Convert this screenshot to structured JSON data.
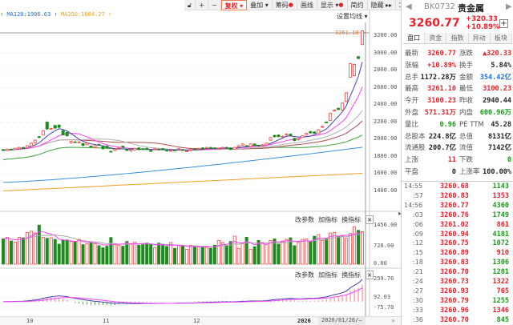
{
  "toolbar": {
    "items": [
      "复权",
      "叠加",
      "筹码",
      "画线",
      "显示",
      "简约",
      "隐藏"
    ],
    "lock_icon": "lock-icon",
    "zoom_in": "+",
    "zoom_out": "−",
    "expand_icon": "fullscreen-icon"
  },
  "legend": {
    "ma120": "MA120:1906.63",
    "ma250": "MA250:1604.27",
    "set_ma": "设置均线 ▾"
  },
  "colors": {
    "up": "#f04848",
    "down": "#1f8a1f",
    "ma5": "#4040b0",
    "ma10": "#ff40ff",
    "ma20": "#b0b0b0",
    "ma30": "#b04848",
    "ma60": "#3aa03a",
    "ma120": "#3a90e0",
    "ma250": "#f0a020"
  },
  "chart_data": {
    "type": "candlestick",
    "price_axis": [
      "3200.00",
      "3000.00",
      "2800.00",
      "2600.00",
      "2400.00",
      "2200.00",
      "2000.00",
      "1800.00",
      "1600.00",
      "1400.00"
    ],
    "price_ticks": [
      3200,
      3000,
      2800,
      2600,
      2400,
      2200,
      2000,
      1800,
      1600,
      1400
    ],
    "high_label": "3261.10",
    "high_value": 3261.1,
    "ma_end": {
      "ma120": 1906.63,
      "ma250": 1604.27
    },
    "candles": [
      [
        1880,
        1870
      ],
      [
        1870,
        1885
      ],
      [
        1885,
        1878
      ],
      [
        1880,
        1895
      ],
      [
        1890,
        1905
      ],
      [
        1905,
        1900
      ],
      [
        1900,
        1925
      ],
      [
        1920,
        1955
      ],
      [
        1960,
        1990
      ],
      [
        2030,
        2020
      ],
      [
        2050,
        2100
      ],
      [
        2200,
        2120
      ],
      [
        2120,
        2125
      ],
      [
        2160,
        2130
      ],
      [
        2165,
        2140
      ],
      [
        2100,
        2050
      ],
      [
        2080,
        2040
      ],
      [
        1960,
        1975
      ],
      [
        1970,
        1968
      ],
      [
        1960,
        1970
      ],
      [
        1950,
        1930
      ],
      [
        1935,
        1955
      ],
      [
        1920,
        1915
      ],
      [
        1905,
        1925
      ],
      [
        1940,
        1930
      ],
      [
        1915,
        1890
      ],
      [
        1920,
        1900
      ],
      [
        1860,
        1850
      ],
      [
        1870,
        1885
      ],
      [
        1895,
        1905
      ],
      [
        1920,
        1905
      ],
      [
        1880,
        1870
      ],
      [
        1865,
        1880
      ],
      [
        1875,
        1895
      ],
      [
        1900,
        1880
      ],
      [
        1890,
        1885
      ],
      [
        1895,
        1880
      ],
      [
        1870,
        1860
      ],
      [
        1880,
        1890
      ],
      [
        1885,
        1882
      ],
      [
        1890,
        1880
      ],
      [
        1875,
        1865
      ],
      [
        1860,
        1870
      ],
      [
        1875,
        1872
      ],
      [
        1880,
        1890
      ],
      [
        1880,
        1870
      ],
      [
        1860,
        1865
      ],
      [
        1870,
        1880
      ],
      [
        1885,
        1880
      ],
      [
        1890,
        1893
      ],
      [
        1900,
        1890
      ],
      [
        1895,
        1905
      ],
      [
        1905,
        1895
      ],
      [
        1900,
        1898
      ],
      [
        1890,
        1895
      ],
      [
        1895,
        1905
      ],
      [
        1905,
        1898
      ],
      [
        1900,
        1880
      ],
      [
        1885,
        1905
      ],
      [
        1910,
        1925
      ],
      [
        1930,
        1945
      ],
      [
        1925,
        1915
      ],
      [
        1915,
        1945
      ],
      [
        1945,
        1925
      ],
      [
        1930,
        1920
      ],
      [
        1925,
        1935
      ],
      [
        1935,
        1955
      ],
      [
        1990,
        2020
      ],
      [
        2045,
        2030
      ],
      [
        2050,
        2030
      ],
      [
        2030,
        2035
      ],
      [
        2050,
        2060
      ],
      [
        2060,
        2045
      ],
      [
        2010,
        1985
      ],
      [
        1995,
        2010
      ],
      [
        2020,
        2040
      ],
      [
        2050,
        2070
      ],
      [
        2090,
        2075
      ],
      [
        2085,
        2070
      ],
      [
        2065,
        2110
      ],
      [
        2140,
        2150
      ],
      [
        2200,
        2195
      ],
      [
        2220,
        2300
      ],
      [
        2330,
        2340
      ],
      [
        2360,
        2345
      ],
      [
        2340,
        2420
      ],
      [
        2440,
        2540
      ],
      [
        2720,
        2880
      ],
      [
        2740,
        2870
      ],
      [
        2960,
        2940.44
      ],
      [
        3100.23,
        3260.77
      ]
    ],
    "volume_axis": [
      "1456.00",
      "728.00",
      "0.00"
    ],
    "volume_max": 1456,
    "volumes": [
      960,
      1010,
      880,
      840,
      1020,
      1000,
      1200,
      1250,
      1180,
      1480,
      1020,
      980,
      1000,
      940,
      760,
      920,
      920,
      860,
      850,
      940,
      740,
      780,
      820,
      780,
      700,
      620,
      680,
      1010,
      740,
      720,
      680,
      860,
      780,
      830,
      720,
      740,
      800,
      760,
      620,
      800,
      710,
      670,
      820,
      600,
      720,
      700,
      560,
      720,
      660,
      650,
      680,
      640,
      600,
      720,
      900,
      820,
      700,
      860,
      1060,
      600,
      800,
      1020,
      560,
      660,
      900,
      820,
      760,
      900,
      960,
      760,
      880,
      940,
      1000,
      700,
      820,
      940,
      960,
      860,
      1060,
      1120,
      900,
      960,
      1180,
      1200,
      1060,
      1060,
      980,
      1160,
      1420,
      1280,
      1230
    ],
    "macd_axis": [
      "259.76",
      "92.03",
      "-75.70"
    ],
    "macd_ticks": [
      259.76,
      92.03,
      -75.7
    ],
    "x_labels": [
      "10",
      "11",
      "12",
      "2026"
    ],
    "cursor_date": "2026/01/26/—"
  },
  "panels": {
    "edit_params": "改参数",
    "add_indicator": "加指标",
    "switch_indicator": "换指标",
    "close": "×"
  },
  "quote": {
    "code": "BK0732",
    "name": "贵金属",
    "price": "3260.77",
    "change": "+320.33",
    "change_pct": "+10.89%",
    "tabs": [
      "盘口",
      "资金",
      "指数",
      "异动",
      "板块"
    ],
    "rows": [
      {
        "l1": "最新",
        "v1": "3260.77",
        "c1": "red",
        "l2": "涨跌",
        "v2": "▲320.33",
        "c2": "red"
      },
      {
        "l1": "涨幅",
        "v1": "+10.89%",
        "c1": "red",
        "l2": "换手",
        "v2": "5.84%",
        "c2": "dk"
      },
      {
        "l1": "总手",
        "v1": "1172.28万",
        "c1": "dk",
        "l2": "金额",
        "v2": "354.42亿",
        "c2": "blu"
      },
      {
        "l1": "最高",
        "v1": "3261.10",
        "c1": "red",
        "l2": "最低",
        "v2": "3100.23",
        "c2": "red"
      },
      {
        "l1": "今开",
        "v1": "3100.23",
        "c1": "red",
        "l2": "昨收",
        "v2": "2940.44",
        "c2": "dk"
      },
      {
        "l1": "外盘",
        "v1": "571.31万",
        "c1": "red",
        "l2": "内盘",
        "v2": "600.96万",
        "c2": "grn"
      },
      {
        "l1": "量比",
        "v1": "0.96",
        "c1": "grn",
        "l2": "PE TTM",
        "v2": "45.28",
        "c2": "dk"
      },
      {
        "l1": "总股本",
        "v1": "224.8亿",
        "c1": "dk",
        "l2": "总值",
        "v2": "8131亿",
        "c2": "dk"
      },
      {
        "l1": "流通股",
        "v1": "200.7亿",
        "c1": "dk",
        "l2": "流值",
        "v2": "7142亿",
        "c2": "dk"
      },
      {
        "l1": "上涨",
        "v1": "11",
        "c1": "red",
        "l2": "下跌",
        "v2": "0",
        "c2": "grn"
      },
      {
        "l1": "平盘",
        "v1": "0",
        "c1": "dk",
        "l2": "上涨率",
        "v2": "100.00%",
        "c2": "dk"
      }
    ],
    "ticks": [
      {
        "t": "14:55",
        "p": "3260.68",
        "v": "1143",
        "vc": "grn"
      },
      {
        "t": ":57",
        "p": "3260.83",
        "v": "1353",
        "vc": "red"
      },
      {
        "t": "14:56",
        "p": "3260.77",
        "v": "4360",
        "vc": "grn"
      },
      {
        "t": ":03",
        "p": "3260.76",
        "v": "1749",
        "vc": "grn"
      },
      {
        "t": ":06",
        "p": "3261.02",
        "v": "861",
        "vc": "red"
      },
      {
        "t": ":09",
        "p": "3260.94",
        "v": "4181",
        "vc": "grn"
      },
      {
        "t": ":12",
        "p": "3260.75",
        "v": "1072",
        "vc": "grn"
      },
      {
        "t": ":15",
        "p": "3260.89",
        "v": "910",
        "vc": "red"
      },
      {
        "t": ":18",
        "p": "3260.83",
        "v": "1306",
        "vc": "grn"
      },
      {
        "t": ":21",
        "p": "3260.70",
        "v": "1281",
        "vc": "grn"
      },
      {
        "t": ":24",
        "p": "3260.73",
        "v": "1322",
        "vc": "red"
      },
      {
        "t": ":27",
        "p": "3260.93",
        "v": "765",
        "vc": "red"
      },
      {
        "t": ":30",
        "p": "3260.79",
        "v": "1255",
        "vc": "grn"
      },
      {
        "t": ":33",
        "p": "3260.96",
        "v": "1346",
        "vc": "red"
      },
      {
        "t": ":36",
        "p": "3260.70",
        "v": "845",
        "vc": "grn"
      }
    ]
  }
}
